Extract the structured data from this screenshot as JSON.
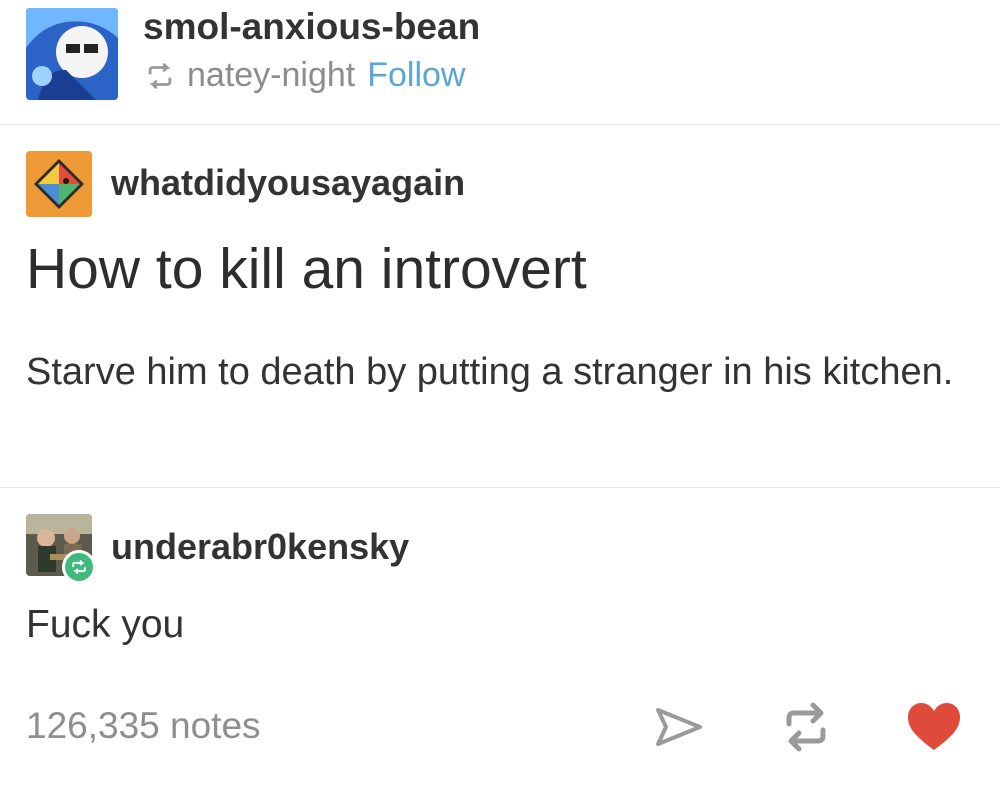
{
  "header": {
    "username": "smol-anxious-bean",
    "reblogged_from": "natey-night",
    "follow_label": "Follow"
  },
  "post": {
    "author": "whatdidyousayagain",
    "title": "How to kill an introvert",
    "body": "Starve him to death by putting a stranger in his kitchen."
  },
  "reply": {
    "author": "underabr0kensky",
    "body": "Fuck you"
  },
  "footer": {
    "notes": "126,335 notes"
  },
  "colors": {
    "heart": "#e04a3b",
    "reblog_badge": "#3fba7a",
    "avatar_orange": "#ee9a36",
    "follow_link": "#5aa7d6"
  },
  "icons": {
    "share": "paper-plane-icon",
    "reblog": "reblog-icon",
    "like": "heart-icon"
  }
}
